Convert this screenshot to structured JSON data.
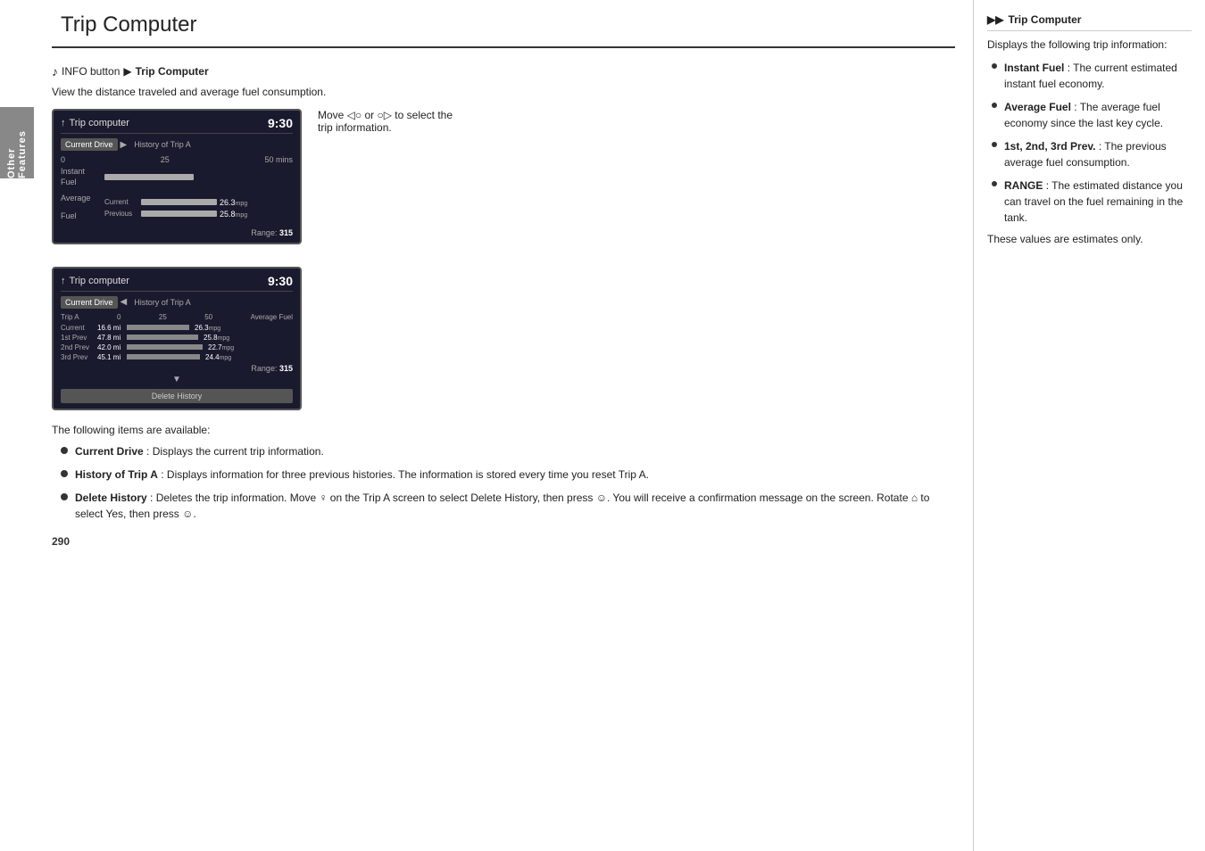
{
  "header": {
    "title": "Trip Computer"
  },
  "breadcrumb": {
    "icon": "🎵",
    "prefix": "INFO button",
    "arrow": "▶",
    "bold": "Trip Computer"
  },
  "description": "View the distance traveled and average fuel consumption.",
  "move_instruction": "Move ◁○ or ○▷ to select the trip information.",
  "screen1": {
    "title": "Trip computer",
    "time": "9:30",
    "tab_active": "Current Drive",
    "tab_arrow": "▶",
    "tab_inactive": "History of Trip A",
    "top_labels": [
      "0",
      "25",
      "50 mins"
    ],
    "row1_label": "Instant\nFuel",
    "row2_label": "Average\nFuel",
    "row2_sub1": "Current",
    "row2_val1": "26.3",
    "row2_unit1": "mpg",
    "row2_sub2": "Previous",
    "row2_val2": "25.8",
    "row2_unit2": "mpg",
    "range_label": "Range:",
    "range_value": "315"
  },
  "screen2": {
    "title": "Trip computer",
    "time": "9:30",
    "tab_active": "Current Drive",
    "tab_arrow": "◀",
    "tab_inactive": "History of Trip A",
    "top_labels": [
      "Trip A",
      "0",
      "25",
      "50",
      "Average Fuel"
    ],
    "row_current_label": "Current",
    "row_current_dist": "16.6 mi",
    "row_current_val": "26.3",
    "row_current_unit": "mpg",
    "row1_label": "1st Prev",
    "row1_dist": "47.8 mi",
    "row1_val": "25.8",
    "row1_unit": "mpg",
    "row2_label": "2nd Prev",
    "row2_dist": "42.0 mi",
    "row2_val": "22.7",
    "row2_unit": "mpg",
    "row3_label": "3rd Prev",
    "row3_dist": "45.1 mi",
    "row3_val": "24.4",
    "row3_unit": "mpg",
    "range_label": "Range:",
    "range_value": "315",
    "delete_btn": "Delete History"
  },
  "bullets": [
    {
      "term": "Current Drive",
      "text": ": Displays the current trip information."
    },
    {
      "term": "History of Trip A",
      "text": ": Displays information for three previous histories. The information is stored every time you reset Trip A."
    },
    {
      "term": "Delete History",
      "text": ": Deletes the trip information. Move ♀ on the Trip A screen to select Delete History, then press ☺. You will receive a confirmation message on the screen. Rotate ⌂ to select Yes, then press ☺."
    }
  ],
  "page_number": "290",
  "sidebar_label": "Other Features",
  "right_panel": {
    "icon": "▶▶",
    "title": "Trip Computer",
    "intro": "Displays the following trip information:",
    "bullets": [
      {
        "term": "Instant Fuel",
        "text": ": The current estimated instant fuel economy."
      },
      {
        "term": "Average Fuel",
        "text": ": The average fuel economy since the last key cycle."
      },
      {
        "term": "1st, 2nd, 3rd Prev.",
        "text": ": The previous average fuel consumption."
      },
      {
        "term": "RANGE",
        "text": ": The estimated distance you can travel on the fuel remaining in the tank."
      }
    ],
    "note": "These values are estimates only."
  }
}
